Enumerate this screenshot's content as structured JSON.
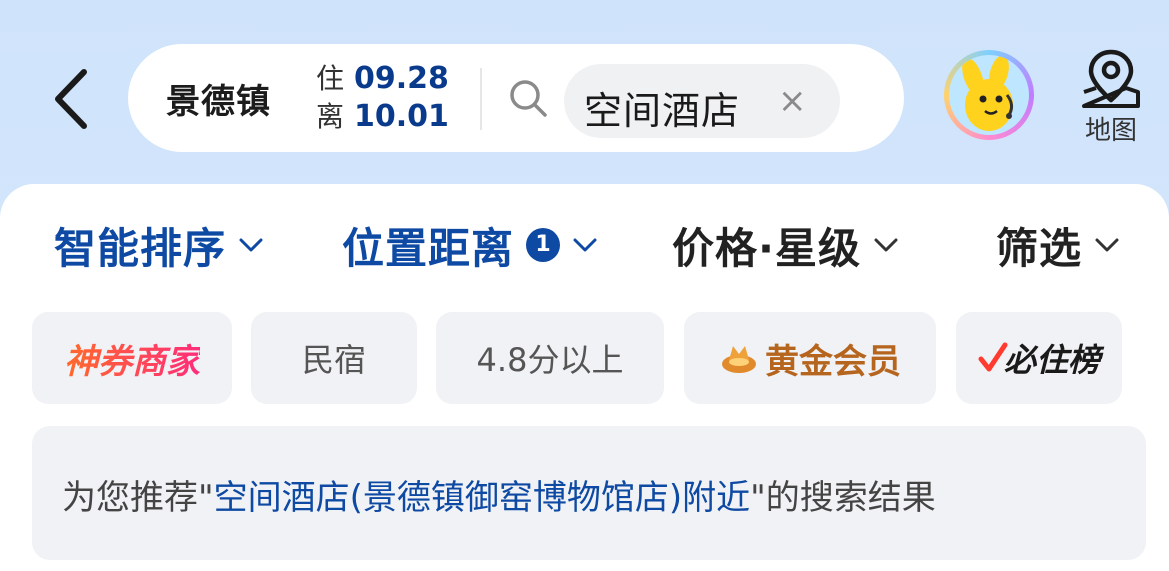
{
  "header": {
    "city": "景德镇",
    "checkin_label": "住",
    "checkin_date": "09.28",
    "checkout_label": "离",
    "checkout_date": "10.01",
    "search_keyword": "空间酒店",
    "clear_glyph": "×",
    "map_label": "地图"
  },
  "sort_bar": {
    "smart_sort": "智能排序",
    "location": "位置距离",
    "location_badge": "1",
    "price_star": "价格·星级",
    "filter": "筛选"
  },
  "tags": [
    {
      "label": "神券商家"
    },
    {
      "label": "民宿"
    },
    {
      "label": "4.8分以上"
    },
    {
      "label": "黄金会员"
    },
    {
      "label": "必住榜"
    }
  ],
  "result": {
    "prefix": "为您推荐\"",
    "keyword": "空间酒店(景德镇御窑博物馆店)附近",
    "suffix": "\"的搜索结果"
  },
  "colors": {
    "accent_blue": "#0e4aa3",
    "brand_gradient_start": "#ff6a2a",
    "brand_gradient_end": "#ff2d7a",
    "gold": "#b5651d"
  },
  "icons": [
    "back-arrow-icon",
    "search-icon",
    "close-icon",
    "mascot-avatar",
    "map-pin-icon",
    "chevron-down-icon",
    "coin-icon",
    "check-icon"
  ]
}
